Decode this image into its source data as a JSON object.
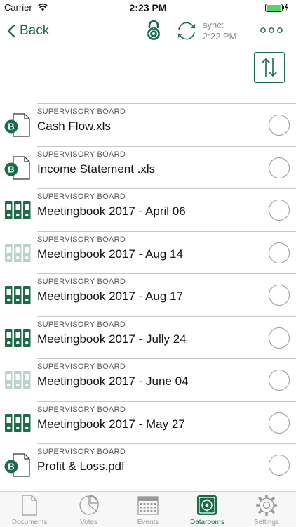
{
  "status": {
    "carrier": "Carrier",
    "time": "2:23 PM"
  },
  "nav": {
    "back_label": "Back",
    "sync_label": "sync:",
    "sync_time": "2:22 PM"
  },
  "colors": {
    "accent": "#1a6b4a",
    "accent_faded": "#bcd3c8",
    "divider": "#c8c8c8",
    "tab_inactive": "#9a9a9a"
  },
  "documents": [
    {
      "category": "SUPERVISORY BOARD",
      "title": "Cash Flow.xls",
      "icon": "document-b-icon",
      "selected": false
    },
    {
      "category": "SUPERVISORY BOARD",
      "title": "Income Statement .xls",
      "icon": "document-b-icon",
      "selected": false
    },
    {
      "category": "SUPERVISORY BOARD",
      "title": "Meetingbook 2017 - April 06",
      "icon": "meetingbook-icon",
      "selected": false
    },
    {
      "category": "SUPERVISORY BOARD",
      "title": "Meetingbook 2017 - Aug 14",
      "icon": "meetingbook-faded-icon",
      "selected": false
    },
    {
      "category": "SUPERVISORY BOARD",
      "title": "Meetingbook 2017 - Aug 17",
      "icon": "meetingbook-icon",
      "selected": false
    },
    {
      "category": "SUPERVISORY BOARD",
      "title": "Meetingbook 2017 - Jully 24",
      "icon": "meetingbook-icon",
      "selected": false
    },
    {
      "category": "SUPERVISORY BOARD",
      "title": "Meetingbook 2017 - June 04",
      "icon": "meetingbook-faded-icon",
      "selected": false
    },
    {
      "category": "SUPERVISORY BOARD",
      "title": "Meetingbook 2017 - May 27",
      "icon": "meetingbook-icon",
      "selected": false
    },
    {
      "category": "SUPERVISORY BOARD",
      "title": "Profit & Loss.pdf",
      "icon": "document-b-icon",
      "selected": false
    }
  ],
  "tabs": [
    {
      "label": "Documents",
      "icon": "document-icon",
      "active": false
    },
    {
      "label": "Votes",
      "icon": "pie-chart-icon",
      "active": false
    },
    {
      "label": "Events",
      "icon": "calendar-icon",
      "active": false
    },
    {
      "label": "Datarooms",
      "icon": "vault-icon",
      "active": true
    },
    {
      "label": "Settings",
      "icon": "gear-icon",
      "active": false
    }
  ]
}
